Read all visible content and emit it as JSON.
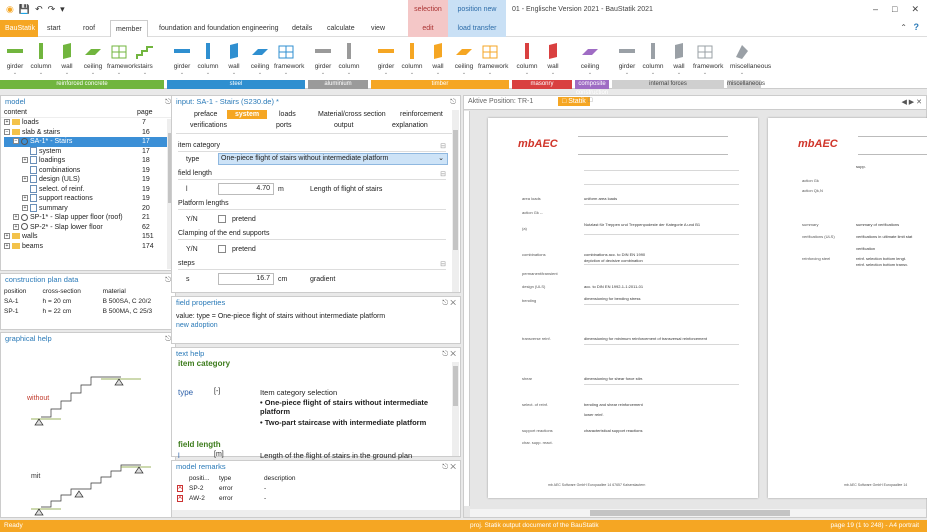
{
  "window": {
    "title": "01 - Englische Version 2021 - BauStatik 2021",
    "controls": [
      "–",
      "□",
      "✕"
    ]
  },
  "contextual": {
    "selection": "selection",
    "position_new": "position new",
    "edit": "edit",
    "load_transfer": "load transfer"
  },
  "tabs": {
    "app": "BauStatik",
    "items": [
      "start",
      "roof",
      "member",
      "foundation and foundation engineering",
      "details",
      "calculate",
      "view"
    ]
  },
  "ribbon": {
    "groups": [
      {
        "label": "reinforced concrete",
        "color": "#71b53e",
        "items": [
          "girder",
          "column",
          "wall",
          "ceiling",
          "framework",
          "stairs"
        ]
      },
      {
        "label": "steel",
        "color": "#2f8fd0",
        "items": [
          "girder",
          "column",
          "wall",
          "ceiling",
          "framework"
        ]
      },
      {
        "label": "aluminium",
        "color": "#9a9a9a",
        "items": [
          "girder",
          "column"
        ]
      },
      {
        "label": "timber",
        "color": "#f5a623",
        "items": [
          "girder",
          "column",
          "wall",
          "ceiling",
          "framework"
        ]
      },
      {
        "label": "masonry",
        "color": "#d94040",
        "items": [
          "column",
          "wall"
        ]
      },
      {
        "label": "composite construction",
        "color": "#9f6cc4",
        "items": [
          "ceiling"
        ]
      },
      {
        "label": "internal forces",
        "color": "#cfcfcf",
        "items": [
          "girder",
          "column",
          "wall",
          "framework"
        ]
      },
      {
        "label": "miscellaneous",
        "color": "#cfcfcf",
        "items": [
          "miscellaneous"
        ]
      }
    ]
  },
  "model": {
    "title": "model",
    "col_content": "content",
    "col_page": "page",
    "rows": [
      {
        "label": "loads",
        "page": "7",
        "depth": 0,
        "exp": "+",
        "icon": "folder"
      },
      {
        "label": "slab & stairs",
        "page": "16",
        "depth": 0,
        "exp": "−",
        "icon": "folder"
      },
      {
        "label": "SA-1* - Stairs",
        "page": "17",
        "depth": 1,
        "exp": "−",
        "icon": "p",
        "sel": true
      },
      {
        "label": "system",
        "page": "17",
        "depth": 2,
        "icon": "doc"
      },
      {
        "label": "loadings",
        "page": "18",
        "depth": 2,
        "exp": "+",
        "icon": "doc"
      },
      {
        "label": "combinations",
        "page": "19",
        "depth": 2,
        "icon": "doc"
      },
      {
        "label": "design (ULS)",
        "page": "19",
        "depth": 2,
        "exp": "+",
        "icon": "doc"
      },
      {
        "label": "select. of reinf.",
        "page": "19",
        "depth": 2,
        "icon": "doc"
      },
      {
        "label": "support reactions",
        "page": "19",
        "depth": 2,
        "exp": "+",
        "icon": "doc"
      },
      {
        "label": "summary",
        "page": "20",
        "depth": 2,
        "exp": "+",
        "icon": "doc"
      },
      {
        "label": "SP-1* - Slap upper floor (roof)",
        "page": "21",
        "depth": 1,
        "exp": "+",
        "icon": "p"
      },
      {
        "label": "SP-2* - Slap lower floor",
        "page": "62",
        "depth": 1,
        "exp": "+",
        "icon": "p"
      },
      {
        "label": "walls",
        "page": "151",
        "depth": 0,
        "exp": "+",
        "icon": "folder"
      },
      {
        "label": "beams",
        "page": "174",
        "depth": 0,
        "exp": "+",
        "icon": "folder"
      }
    ]
  },
  "cp": {
    "title": "construction plan data",
    "headers": [
      "position",
      "cross-section",
      "material"
    ],
    "rows": [
      [
        "SA-1",
        "h = 20 cm",
        "B 500SA, C 20/2"
      ],
      [
        "SP-1",
        "h = 22 cm",
        "B 500MA, C 25/3"
      ]
    ]
  },
  "gh": {
    "title": "graphical help",
    "label_without": "without",
    "label_with": "mit"
  },
  "input": {
    "title": "input: SA-1 - Stairs (S230.de) *",
    "tabs_row1": [
      "preface",
      "system",
      "loads",
      "Material/cross section",
      "reinforcement"
    ],
    "tabs_row2": [
      "verifications",
      "ports",
      "output",
      "explanation"
    ],
    "item_category": "item category",
    "type_label": "type",
    "type_value": "One-piece flight of stairs without intermediate platform",
    "field_length": "field length",
    "l_label": "l",
    "l_value": "4.70",
    "l_unit": "m",
    "l_desc": "Length of flight of stairs",
    "platform_lengths": "Platform lengths",
    "yn": "Y/N",
    "pretend": "pretend",
    "clamping": "Clamping of the end supports",
    "steps": "steps",
    "s_label": "s",
    "s_value": "16.7",
    "s_unit": "cm",
    "s_desc": "gradient"
  },
  "fp": {
    "title": "field properties",
    "value_line": "value: type = One-piece flight of stairs without intermediate platform",
    "new_link": "new adoption"
  },
  "th": {
    "title": "text help",
    "sec1": "item category",
    "type": "type",
    "type_unit": "[-]",
    "sel_title": "Item category selection",
    "opt1": "• One-piece flight of stairs without intermediate platform",
    "opt2": "• Two-part staircase with intermediate platform",
    "sec2": "field length",
    "l": "l",
    "l_unit": "[m]",
    "l_desc": "Length of the flight of stairs in the ground plan"
  },
  "mr": {
    "title": "model remarks",
    "headers": [
      "positi...",
      "type",
      "description"
    ],
    "rows": [
      [
        "SP-2",
        "error",
        "-"
      ],
      [
        "AW-2",
        "error",
        "-"
      ]
    ]
  },
  "doc": {
    "tab_active": "Aktive Position: TR-1",
    "tab_statik": "Statik",
    "nav": "◀ ▶ ✕",
    "left_labels": [
      "area loads",
      "action Gk ‑‑",
      "(a)",
      "combinations",
      "permanent/transient",
      "design (ULS)",
      "bending",
      "transverse reinf.",
      "shear",
      "select. of reinf.",
      "support reactions",
      "char. supp. react."
    ],
    "right_labels": [
      "action Gk",
      "action Qk,N",
      "summary",
      "verifications (ULS)",
      "reinforcing steel"
    ],
    "right_texts": [
      "supp.",
      "summary of verifications",
      "verifications in ultimate limit stat",
      "verification",
      "reinf. selection bottom lengt.",
      "reinf. selection bottom transv."
    ],
    "mid_texts": [
      "uniform area loads",
      "Nutzlast für Treppen und Treppenpodeste der Kategorie A und B1",
      "combinations acc. to DIN EN 1990",
      "depiction of decisive combination",
      "acc. to DIN EN 1992-1-1:2011-01",
      "dimensioning for bending stress",
      "dimensioning for minimum reinforcement of transversal reinforcement",
      "dimensioning for shear force stirr.",
      "bending and shear reinforcement",
      "lower reinf.",
      "characteristical support reactions"
    ],
    "footer": "mb AEC Software GmbH  Europaallee 14  67657 Kaiserslautern",
    "footer_r": "mb AEC Software GmbH  Europaallee 14"
  },
  "status": {
    "left": "Ready",
    "mid": "proj. Statik  output document of the BauStatik",
    "right": "page 19 (1 to 248) - A4  portrait"
  }
}
